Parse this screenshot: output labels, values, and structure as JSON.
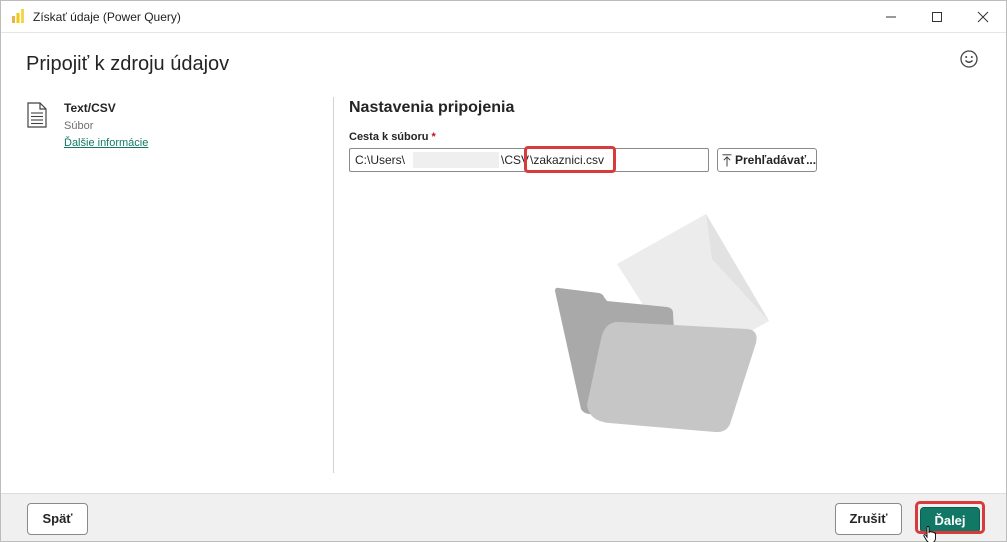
{
  "window": {
    "title": "Získať údaje (Power Query)",
    "controls": {
      "minimize": "minimize-icon",
      "maximize": "maximize-icon",
      "close": "close-icon"
    }
  },
  "header": {
    "title": "Pripojiť k zdroju údajov",
    "feedback_icon": "smiley-icon"
  },
  "connector": {
    "icon": "document-icon",
    "name": "Text/CSV",
    "type": "Súbor",
    "learn_more": "Ďalšie informácie"
  },
  "settings": {
    "title": "Nastavenia pripojenia",
    "file_path_label": "Cesta k súboru",
    "required_marker": "*",
    "file_path_prefix": "C:\\Users\\",
    "file_path_middle": "\\CSV",
    "file_path_file": "\\zakaznici.csv",
    "browse_label": "Prehľadávať..."
  },
  "footer": {
    "back_label": "Späť",
    "cancel_label": "Zrušiť",
    "next_label": "Ďalej"
  },
  "colors": {
    "accent": "#117865",
    "highlight": "#d83b3b",
    "required": "#c50f1f"
  }
}
